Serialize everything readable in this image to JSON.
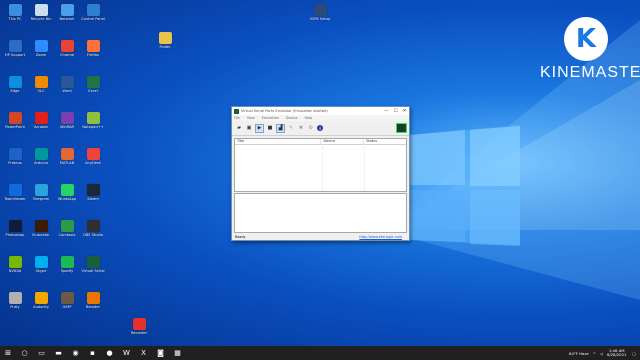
{
  "desktop": {
    "icons": [
      {
        "name": "This PC",
        "color": "#3b8de0"
      },
      {
        "name": "Recycle Bin",
        "color": "#cde"
      },
      {
        "name": "Network",
        "color": "#4aa0e8"
      },
      {
        "name": "Control Panel",
        "color": "#2f7fd0"
      },
      {
        "name": "HP Support",
        "color": "#2b6cc4"
      },
      {
        "name": "Zoom",
        "color": "#2d8cff"
      },
      {
        "name": "Chrome",
        "color": "#ea4335"
      },
      {
        "name": "Firefox",
        "color": "#ff7139"
      },
      {
        "name": "Edge",
        "color": "#0c8fe0"
      },
      {
        "name": "VLC",
        "color": "#f08a00"
      },
      {
        "name": "Word",
        "color": "#2b579a"
      },
      {
        "name": "Excel",
        "color": "#217346"
      },
      {
        "name": "PowerPoint",
        "color": "#d24726"
      },
      {
        "name": "Acrobat",
        "color": "#e0201b"
      },
      {
        "name": "WinRAR",
        "color": "#7a3fb0"
      },
      {
        "name": "Notepad++",
        "color": "#8fc13e"
      },
      {
        "name": "Proteus",
        "color": "#1e62c8"
      },
      {
        "name": "Arduino",
        "color": "#00979d"
      },
      {
        "name": "MATLAB",
        "color": "#e16737"
      },
      {
        "name": "AnyDesk",
        "color": "#ef443b"
      },
      {
        "name": "TeamViewer",
        "color": "#0e6bd8"
      },
      {
        "name": "Telegram",
        "color": "#2aa3de"
      },
      {
        "name": "WhatsApp",
        "color": "#25d366"
      },
      {
        "name": "Steam",
        "color": "#1b2838"
      },
      {
        "name": "Photoshop",
        "color": "#0f1c3a"
      },
      {
        "name": "Illustrator",
        "color": "#3a1c00"
      },
      {
        "name": "Camtasia",
        "color": "#2a9c47"
      },
      {
        "name": "OBS Studio",
        "color": "#302e31"
      },
      {
        "name": "NVIDIA",
        "color": "#76b900"
      },
      {
        "name": "Skype",
        "color": "#00aff0"
      },
      {
        "name": "Spotify",
        "color": "#1db954"
      },
      {
        "name": "Virtual Serial",
        "color": "#1b5f3a"
      },
      {
        "name": "Putty",
        "color": "#b0b0b0"
      },
      {
        "name": "Audacity",
        "color": "#f2a600"
      },
      {
        "name": "GIMP",
        "color": "#6b5b45"
      },
      {
        "name": "Blender",
        "color": "#ea7600"
      }
    ],
    "loose_icons": [
      {
        "name": "VSPE Setup",
        "color": "#2b4a7a"
      },
      {
        "name": "Folder",
        "color": "#e9c44a"
      },
      {
        "name": "Recorder",
        "color": "#e53030"
      }
    ]
  },
  "watermark": {
    "brand": "KINEMASTER",
    "logo_letter": "K"
  },
  "window": {
    "title": "Virtual Serial Ports Emulator (Emulation started)",
    "controls": {
      "min": "—",
      "max": "☐",
      "close": "✕"
    },
    "menu": [
      "File",
      "View",
      "Emulation",
      "Device",
      "Help"
    ],
    "toolbar": [
      {
        "name": "open-icon",
        "glyph": "▰",
        "state": "normal"
      },
      {
        "name": "save-icon",
        "glyph": "▣",
        "state": "normal"
      },
      {
        "name": "play-icon",
        "glyph": "▶",
        "state": "active"
      },
      {
        "name": "stop-icon",
        "glyph": "■",
        "state": "normal"
      },
      {
        "name": "create-device-icon",
        "glyph": "▟",
        "state": "active"
      },
      {
        "name": "edit-device-icon",
        "glyph": "✎",
        "state": "disabled"
      },
      {
        "name": "delete-device-icon",
        "glyph": "✖",
        "state": "disabled"
      },
      {
        "name": "settings-icon",
        "glyph": "⚙",
        "state": "disabled"
      },
      {
        "name": "info-icon",
        "glyph": "i",
        "state": "info"
      }
    ],
    "columns": [
      "Title",
      "Device",
      "Status"
    ],
    "status_text": "Ready",
    "status_link": "http://www.eterlogic.com"
  },
  "taskbar": {
    "start_glyph": "⊞",
    "items": [
      {
        "name": "search-icon",
        "glyph": "○"
      },
      {
        "name": "task-view-icon",
        "glyph": "▭"
      },
      {
        "name": "file-explorer-icon",
        "glyph": "▬"
      },
      {
        "name": "edge-icon",
        "glyph": "◉"
      },
      {
        "name": "acrobat-icon",
        "glyph": "▪"
      },
      {
        "name": "chrome-icon",
        "glyph": "●"
      },
      {
        "name": "word-icon",
        "glyph": "W"
      },
      {
        "name": "excel-icon",
        "glyph": "X"
      },
      {
        "name": "zoom-icon",
        "glyph": "◙"
      },
      {
        "name": "vspe-icon",
        "glyph": "▦"
      }
    ],
    "weather": "84°F Haze",
    "time": "1:46 AM",
    "date": "6/28/2021"
  }
}
